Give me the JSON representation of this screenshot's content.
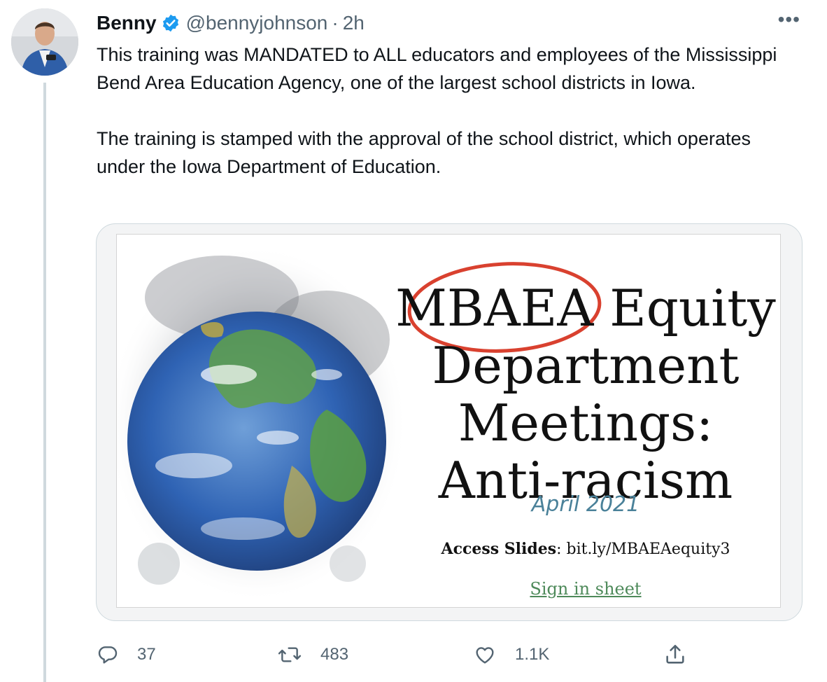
{
  "tweet": {
    "author_name": "Benny",
    "author_handle": "@bennyjohnson",
    "separator": "·",
    "time_ago": "2h",
    "text": "This training was MANDATED to ALL educators and employees of the Mississippi Bend Area Education Agency, one of the largest school districts in Iowa.\n\nThe training is stamped with the approval of the school district, which operates under the Iowa Department of Education.",
    "more_icon": "•••"
  },
  "media": {
    "slide": {
      "title_line1_circled": "MBAEA",
      "title_line1_rest": "Equity",
      "title_line2": "Department",
      "title_line3": "Meetings:",
      "title_line4": "Anti-racism",
      "date": "April 2021",
      "access_label": "Access Slides",
      "access_url": ": bit.ly/MBAEAequity3",
      "sign_in": "Sign in sheet"
    },
    "highlight_color": "#d9412f"
  },
  "actions": {
    "reply_count": "37",
    "retweet_count": "483",
    "like_count": "1.1K",
    "icons": [
      "reply-icon",
      "retweet-icon",
      "like-icon",
      "share-icon"
    ]
  },
  "colors": {
    "verified": "#1d9bf0",
    "secondary_text": "#536471",
    "thread_line": "#cfd9de"
  }
}
